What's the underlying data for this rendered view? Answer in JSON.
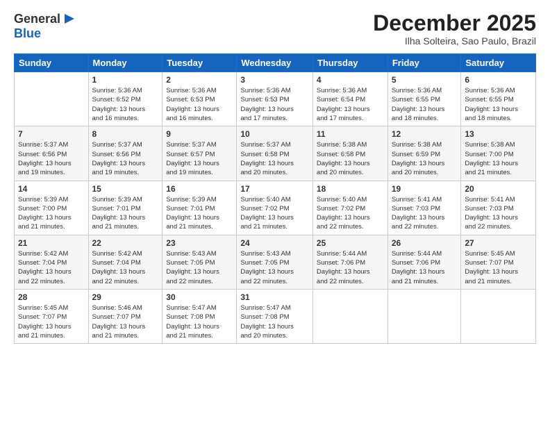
{
  "logo": {
    "general": "General",
    "blue": "Blue"
  },
  "header": {
    "month_title": "December 2025",
    "location": "Ilha Solteira, Sao Paulo, Brazil"
  },
  "days_of_week": [
    "Sunday",
    "Monday",
    "Tuesday",
    "Wednesday",
    "Thursday",
    "Friday",
    "Saturday"
  ],
  "weeks": [
    [
      {
        "day": "",
        "info": ""
      },
      {
        "day": "1",
        "info": "Sunrise: 5:36 AM\nSunset: 6:52 PM\nDaylight: 13 hours\nand 16 minutes."
      },
      {
        "day": "2",
        "info": "Sunrise: 5:36 AM\nSunset: 6:53 PM\nDaylight: 13 hours\nand 16 minutes."
      },
      {
        "day": "3",
        "info": "Sunrise: 5:36 AM\nSunset: 6:53 PM\nDaylight: 13 hours\nand 17 minutes."
      },
      {
        "day": "4",
        "info": "Sunrise: 5:36 AM\nSunset: 6:54 PM\nDaylight: 13 hours\nand 17 minutes."
      },
      {
        "day": "5",
        "info": "Sunrise: 5:36 AM\nSunset: 6:55 PM\nDaylight: 13 hours\nand 18 minutes."
      },
      {
        "day": "6",
        "info": "Sunrise: 5:36 AM\nSunset: 6:55 PM\nDaylight: 13 hours\nand 18 minutes."
      }
    ],
    [
      {
        "day": "7",
        "info": "Sunrise: 5:37 AM\nSunset: 6:56 PM\nDaylight: 13 hours\nand 19 minutes."
      },
      {
        "day": "8",
        "info": "Sunrise: 5:37 AM\nSunset: 6:56 PM\nDaylight: 13 hours\nand 19 minutes."
      },
      {
        "day": "9",
        "info": "Sunrise: 5:37 AM\nSunset: 6:57 PM\nDaylight: 13 hours\nand 19 minutes."
      },
      {
        "day": "10",
        "info": "Sunrise: 5:37 AM\nSunset: 6:58 PM\nDaylight: 13 hours\nand 20 minutes."
      },
      {
        "day": "11",
        "info": "Sunrise: 5:38 AM\nSunset: 6:58 PM\nDaylight: 13 hours\nand 20 minutes."
      },
      {
        "day": "12",
        "info": "Sunrise: 5:38 AM\nSunset: 6:59 PM\nDaylight: 13 hours\nand 20 minutes."
      },
      {
        "day": "13",
        "info": "Sunrise: 5:38 AM\nSunset: 7:00 PM\nDaylight: 13 hours\nand 21 minutes."
      }
    ],
    [
      {
        "day": "14",
        "info": "Sunrise: 5:39 AM\nSunset: 7:00 PM\nDaylight: 13 hours\nand 21 minutes."
      },
      {
        "day": "15",
        "info": "Sunrise: 5:39 AM\nSunset: 7:01 PM\nDaylight: 13 hours\nand 21 minutes."
      },
      {
        "day": "16",
        "info": "Sunrise: 5:39 AM\nSunset: 7:01 PM\nDaylight: 13 hours\nand 21 minutes."
      },
      {
        "day": "17",
        "info": "Sunrise: 5:40 AM\nSunset: 7:02 PM\nDaylight: 13 hours\nand 21 minutes."
      },
      {
        "day": "18",
        "info": "Sunrise: 5:40 AM\nSunset: 7:02 PM\nDaylight: 13 hours\nand 22 minutes."
      },
      {
        "day": "19",
        "info": "Sunrise: 5:41 AM\nSunset: 7:03 PM\nDaylight: 13 hours\nand 22 minutes."
      },
      {
        "day": "20",
        "info": "Sunrise: 5:41 AM\nSunset: 7:03 PM\nDaylight: 13 hours\nand 22 minutes."
      }
    ],
    [
      {
        "day": "21",
        "info": "Sunrise: 5:42 AM\nSunset: 7:04 PM\nDaylight: 13 hours\nand 22 minutes."
      },
      {
        "day": "22",
        "info": "Sunrise: 5:42 AM\nSunset: 7:04 PM\nDaylight: 13 hours\nand 22 minutes."
      },
      {
        "day": "23",
        "info": "Sunrise: 5:43 AM\nSunset: 7:05 PM\nDaylight: 13 hours\nand 22 minutes."
      },
      {
        "day": "24",
        "info": "Sunrise: 5:43 AM\nSunset: 7:05 PM\nDaylight: 13 hours\nand 22 minutes."
      },
      {
        "day": "25",
        "info": "Sunrise: 5:44 AM\nSunset: 7:06 PM\nDaylight: 13 hours\nand 22 minutes."
      },
      {
        "day": "26",
        "info": "Sunrise: 5:44 AM\nSunset: 7:06 PM\nDaylight: 13 hours\nand 21 minutes."
      },
      {
        "day": "27",
        "info": "Sunrise: 5:45 AM\nSunset: 7:07 PM\nDaylight: 13 hours\nand 21 minutes."
      }
    ],
    [
      {
        "day": "28",
        "info": "Sunrise: 5:45 AM\nSunset: 7:07 PM\nDaylight: 13 hours\nand 21 minutes."
      },
      {
        "day": "29",
        "info": "Sunrise: 5:46 AM\nSunset: 7:07 PM\nDaylight: 13 hours\nand 21 minutes."
      },
      {
        "day": "30",
        "info": "Sunrise: 5:47 AM\nSunset: 7:08 PM\nDaylight: 13 hours\nand 21 minutes."
      },
      {
        "day": "31",
        "info": "Sunrise: 5:47 AM\nSunset: 7:08 PM\nDaylight: 13 hours\nand 20 minutes."
      },
      {
        "day": "",
        "info": ""
      },
      {
        "day": "",
        "info": ""
      },
      {
        "day": "",
        "info": ""
      }
    ]
  ]
}
